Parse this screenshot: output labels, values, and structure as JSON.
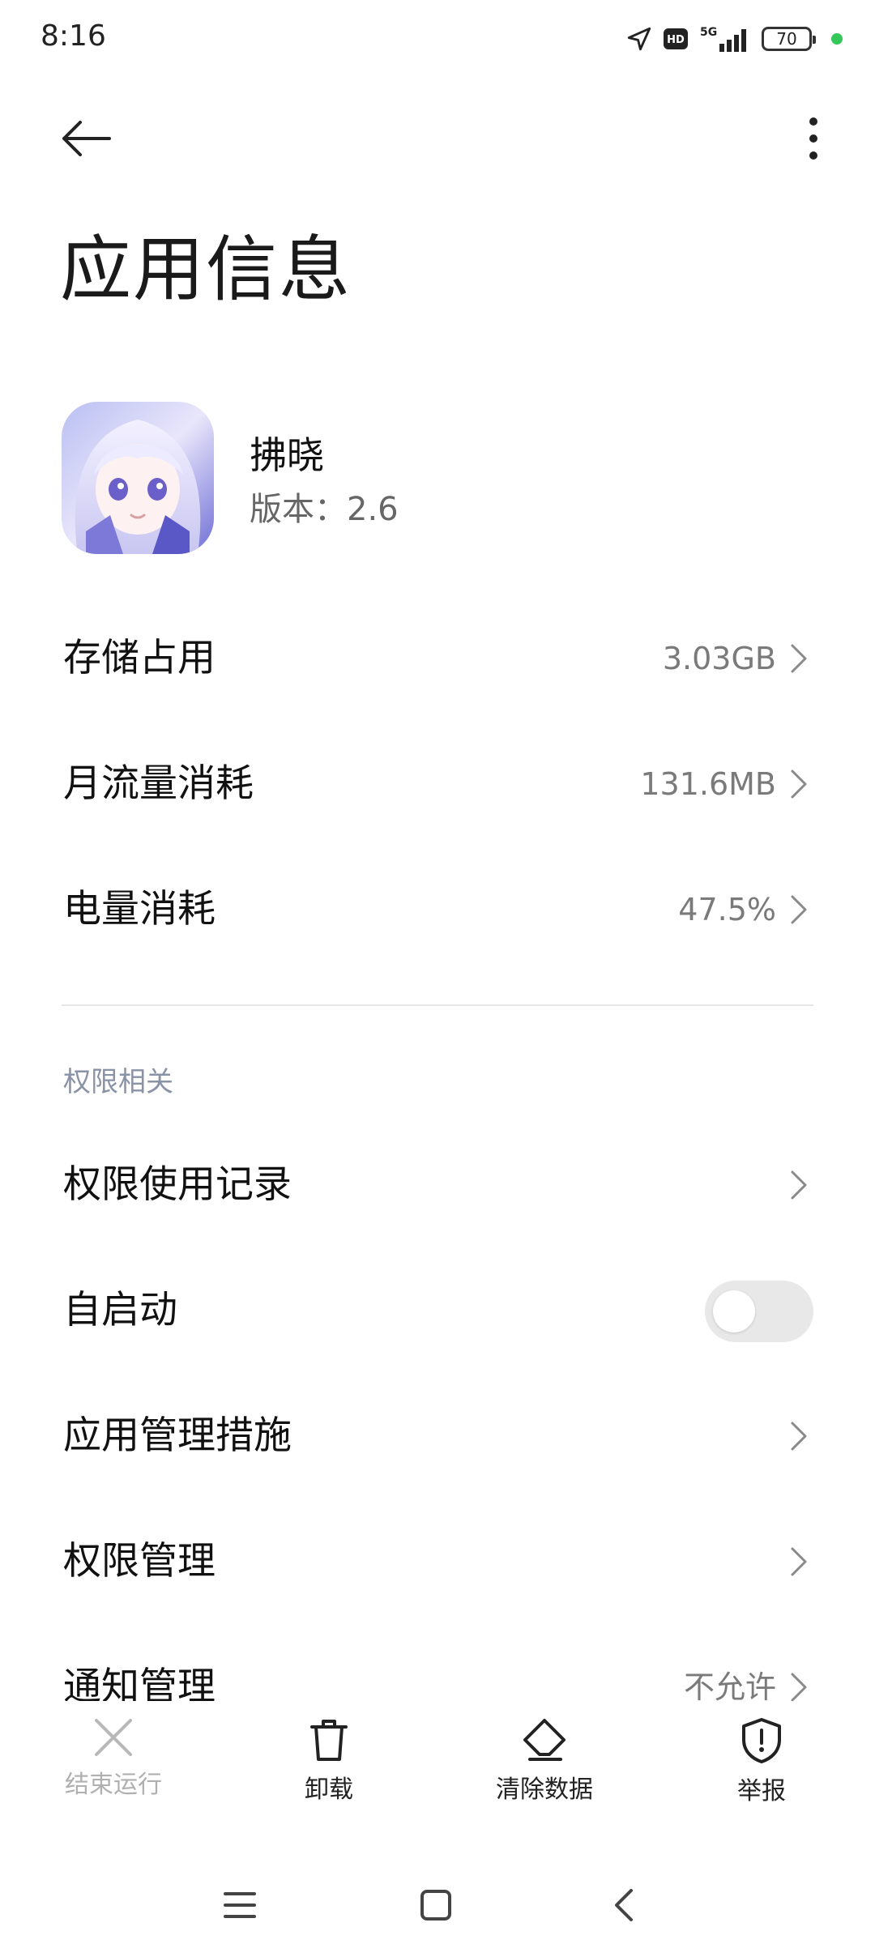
{
  "status_bar": {
    "time": "8:16",
    "battery": "70",
    "icons": [
      "location-icon",
      "hd-icon",
      "5g-signal-icon",
      "battery-icon",
      "indicator-dot"
    ]
  },
  "header": {
    "title": "应用信息"
  },
  "app": {
    "name": "拂晓",
    "version": "版本：2.6"
  },
  "rows": {
    "storage": {
      "label": "存储占用",
      "value": "3.03GB"
    },
    "traffic": {
      "label": "月流量消耗",
      "value": "131.6MB"
    },
    "battery": {
      "label": "电量消耗",
      "value": "47.5%"
    }
  },
  "permissions_section": {
    "header": "权限相关",
    "usage_record": {
      "label": "权限使用记录"
    },
    "autostart": {
      "label": "自启动",
      "enabled": false
    },
    "app_management": {
      "label": "应用管理措施"
    },
    "permission_management": {
      "label": "权限管理"
    },
    "notification_management": {
      "label": "通知管理",
      "value": "不允许"
    }
  },
  "actions": {
    "force_stop": "结束运行",
    "uninstall": "卸载",
    "clear_data": "清除数据",
    "report": "举报"
  },
  "colors": {
    "accent_green": "#34c759",
    "secondary_text": "#7a7a7a",
    "section_header": "#8a92a6"
  }
}
